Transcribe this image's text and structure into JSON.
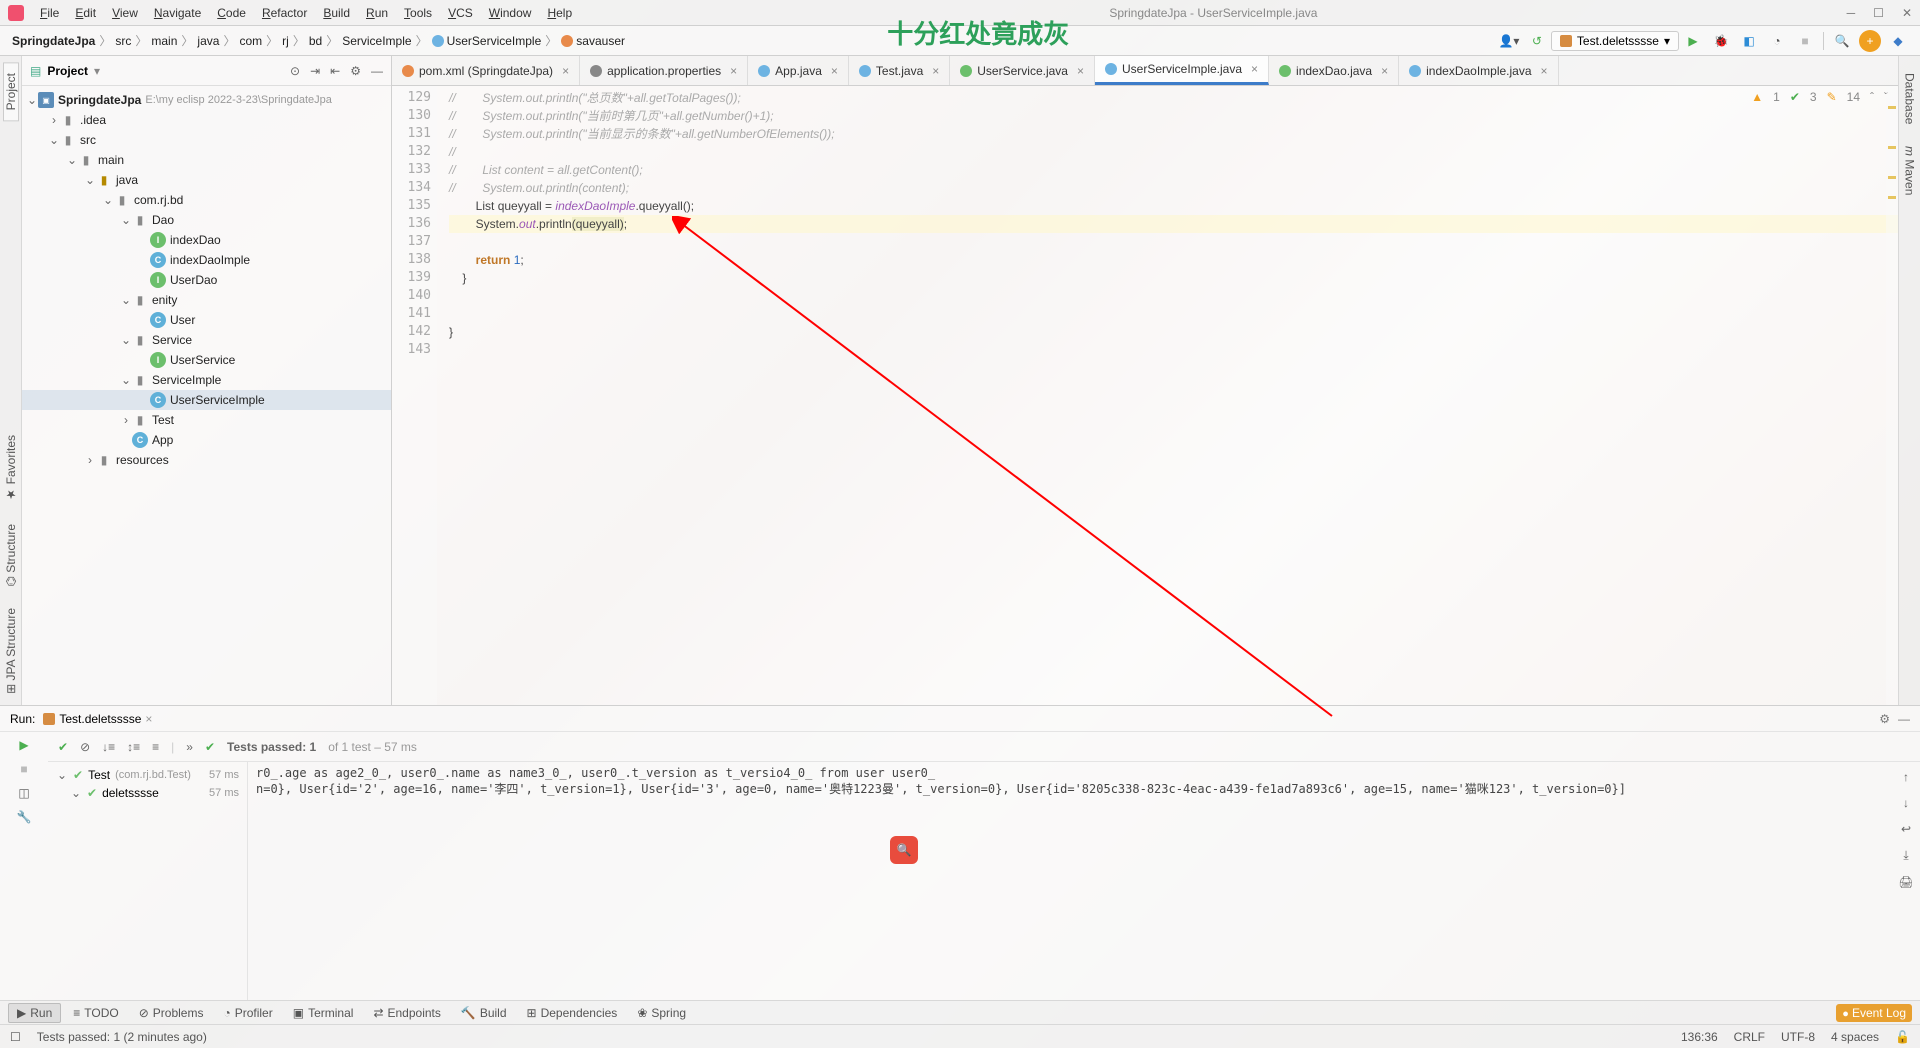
{
  "window_title": "SpringdateJpa - UserServiceImple.java",
  "ghost_text": "十分红处竟成灰",
  "menus": [
    "File",
    "Edit",
    "View",
    "Navigate",
    "Code",
    "Refactor",
    "Build",
    "Run",
    "Tools",
    "VCS",
    "Window",
    "Help"
  ],
  "breadcrumbs": {
    "items": [
      "SpringdateJpa",
      "src",
      "main",
      "java",
      "com",
      "rj",
      "bd",
      "ServiceImple",
      "UserServiceImple",
      "savauser"
    ],
    "bold_first": true
  },
  "run_config_label": "Test.deletsssse",
  "left_tabs": [
    "Project"
  ],
  "right_tabs": [
    "Database",
    "Maven"
  ],
  "project": {
    "panel_title": "Project",
    "root": "SpringdateJpa",
    "root_path": "E:\\my eclisp 2022-3-23\\SpringdateJpa",
    "tree": [
      {
        "d": 1,
        "t": "folder",
        "open": false,
        "label": ".idea",
        "dim": ""
      },
      {
        "d": 1,
        "t": "folder",
        "open": true,
        "label": "src"
      },
      {
        "d": 2,
        "t": "folder",
        "open": true,
        "label": "main"
      },
      {
        "d": 3,
        "t": "jfolder",
        "open": true,
        "label": "java"
      },
      {
        "d": 4,
        "t": "folder",
        "open": true,
        "label": "com.rj.bd"
      },
      {
        "d": 5,
        "t": "folder",
        "open": true,
        "label": "Dao"
      },
      {
        "d": 6,
        "t": "intf",
        "label": "indexDao"
      },
      {
        "d": 6,
        "t": "cls",
        "label": "indexDaoImple"
      },
      {
        "d": 6,
        "t": "intf",
        "label": "UserDao"
      },
      {
        "d": 5,
        "t": "folder",
        "open": true,
        "label": "enity"
      },
      {
        "d": 6,
        "t": "cls",
        "label": "User"
      },
      {
        "d": 5,
        "t": "folder",
        "open": true,
        "label": "Service"
      },
      {
        "d": 6,
        "t": "intf",
        "label": "UserService"
      },
      {
        "d": 5,
        "t": "folder",
        "open": true,
        "label": "ServiceImple",
        "sel": false
      },
      {
        "d": 6,
        "t": "cls",
        "label": "UserServiceImple",
        "sel": true
      },
      {
        "d": 5,
        "t": "folder",
        "open": false,
        "label": "Test"
      },
      {
        "d": 5,
        "t": "cls",
        "label": "App"
      },
      {
        "d": 3,
        "t": "folder",
        "open": false,
        "label": "resources"
      }
    ]
  },
  "editor_tabs": [
    {
      "icon": "corg",
      "label": "pom.xml (SpringdateJpa)"
    },
    {
      "icon": "cgear",
      "label": "application.properties"
    },
    {
      "icon": "cblue",
      "label": "App.java"
    },
    {
      "icon": "cblue",
      "label": "Test.java"
    },
    {
      "icon": "cgreen",
      "label": "UserService.java"
    },
    {
      "icon": "cblue",
      "label": "UserServiceImple.java",
      "active": true
    },
    {
      "icon": "cgreen",
      "label": "indexDao.java"
    },
    {
      "icon": "cblue",
      "label": "indexDaoImple.java"
    }
  ],
  "code": {
    "first_line": 129,
    "lines": [
      "//        System.out.println(\"总页数\"+all.getTotalPages());",
      "//        System.out.println(\"当前时第几页\"+all.getNumber()+1);",
      "//        System.out.println(\"当前显示的条数\"+all.getNumberOfElements());",
      "//",
      "//        List<User> content = all.getContent();",
      "//        System.out.println(content);",
      "        List<User> queyyall = <fld>indexDaoImple</fld>.queyyall();",
      "        System.<fld>out</fld>.println<hl>(queyyall)</hl>;",
      "",
      "        <kw>return</kw> <num>1</num>;",
      "    }",
      "",
      "",
      "}",
      ""
    ]
  },
  "inspections": {
    "warn": "1",
    "ok": "3",
    "typo": "14"
  },
  "run_panel": {
    "title": "Run:",
    "config": "Test.deletsssse",
    "status_line": "Tests passed: 1",
    "status_tail": " of 1 test – 57 ms",
    "tests": [
      {
        "name": "Test",
        "pkg": "(com.rj.bd.Test)",
        "time": "57 ms",
        "d": 0
      },
      {
        "name": "deletsssse",
        "pkg": "",
        "time": "57 ms",
        "d": 1
      }
    ],
    "console_lines": [
      "r0_.age as age2_0_, user0_.name as name3_0_, user0_.t_version as t_versio4_0_ from user user0_",
      "n=0}, User{id='2', age=16, name='李四', t_version=1}, User{id='3', age=0, name='奥特1223曼', t_version=0}, User{id='8205c338-823c-4eac-a439-fe1ad7a893c6', age=15, name='猫咪123', t_version=0}]"
    ]
  },
  "bottom_tools": [
    "Run",
    "TODO",
    "Problems",
    "Profiler",
    "Terminal",
    "Endpoints",
    "Build",
    "Dependencies",
    "Spring"
  ],
  "event_log": "Event Log",
  "status": {
    "msg": "Tests passed: 1 (2 minutes ago)",
    "pos": "136:36",
    "le": "CRLF",
    "enc": "UTF-8",
    "indent": "4 spaces"
  }
}
